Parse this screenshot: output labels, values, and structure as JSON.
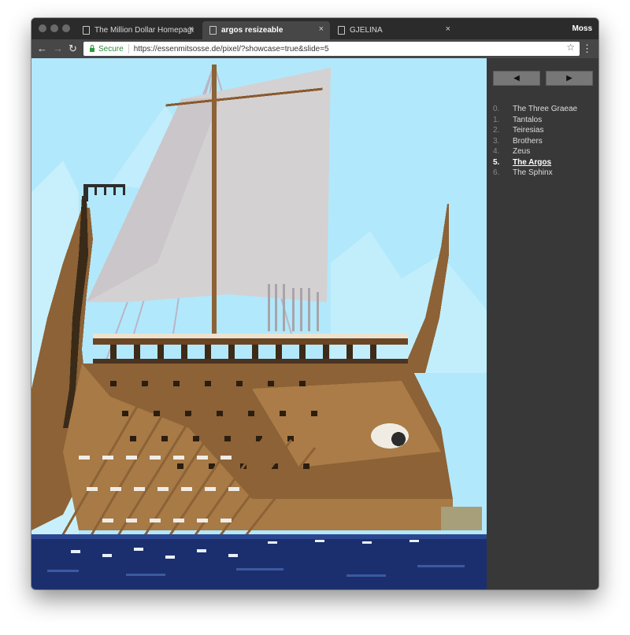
{
  "browser": {
    "profile_name": "Moss",
    "tabs": [
      {
        "label": "The Million Dollar Homepage - O",
        "active": false
      },
      {
        "label": "argos resizeable",
        "active": true
      },
      {
        "label": "GJELINA",
        "active": false
      }
    ],
    "close_glyph": "×",
    "nav": {
      "back": "←",
      "forward": "→",
      "reload": "↻"
    },
    "address": {
      "secure_label": "Secure",
      "url": "https://essenmitsosse.de/pixel/?showcase=true&slide=5"
    },
    "bookmark_glyph": "☆",
    "menu_glyph": "⋮"
  },
  "artwork": {
    "subject": "pixel art of the Argos galley ship with sail and oars on the sea",
    "colors": {
      "sky": "#b2e8fb",
      "sail": "#d4d1d3",
      "hull": "#8c6236",
      "sea": "#1b2f6e"
    }
  },
  "sidebar": {
    "prev_label": "◀",
    "next_label": "▶",
    "current_index": 5,
    "slides": [
      {
        "num": "0.",
        "title": "The Three Graeae"
      },
      {
        "num": "1.",
        "title": "Tantalos"
      },
      {
        "num": "2.",
        "title": "Teiresias"
      },
      {
        "num": "3.",
        "title": "Brothers"
      },
      {
        "num": "4.",
        "title": "Zeus"
      },
      {
        "num": "5.",
        "title": "The Argos"
      },
      {
        "num": "6.",
        "title": "The Sphinx"
      }
    ]
  }
}
